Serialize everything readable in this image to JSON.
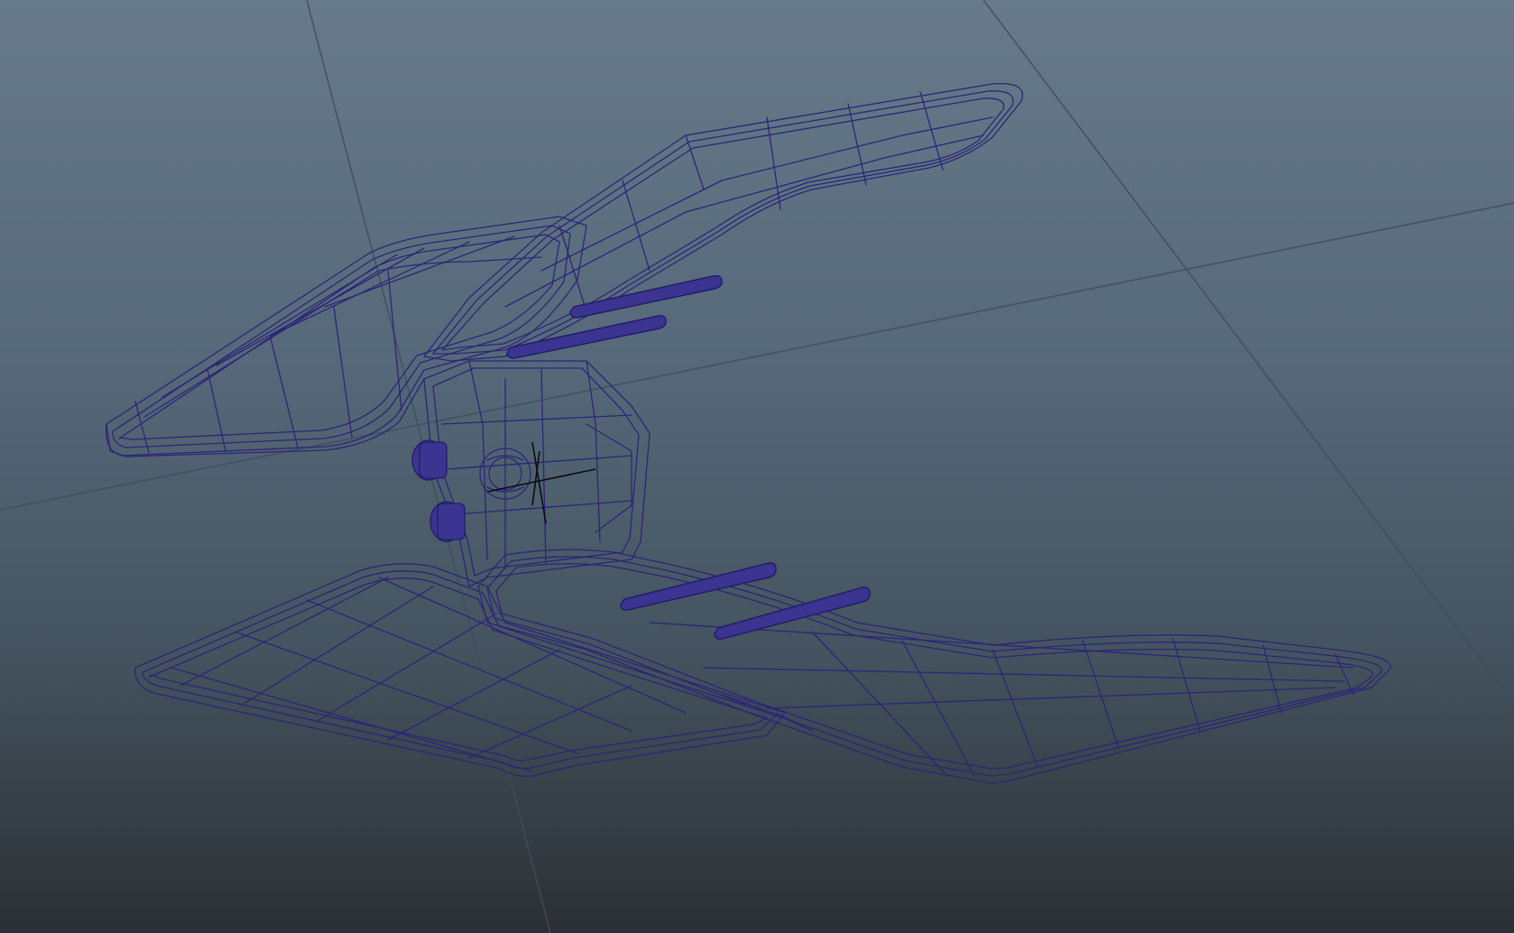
{
  "viewport": {
    "gradient_colors": [
      "#677a8a",
      "#56697a",
      "#44535f",
      "#2b3035"
    ],
    "grid_color": "#3f4d59",
    "wire_color": "#2c2577",
    "wire_highlight": "#4f47a8",
    "solid_color": "#3b3490",
    "pivot_color": "#0b0d10"
  },
  "scene": {
    "object": "wireframe-model",
    "display_mode": "wireframe"
  },
  "icons": {
    "pivot": "transform-pivot-icon"
  }
}
